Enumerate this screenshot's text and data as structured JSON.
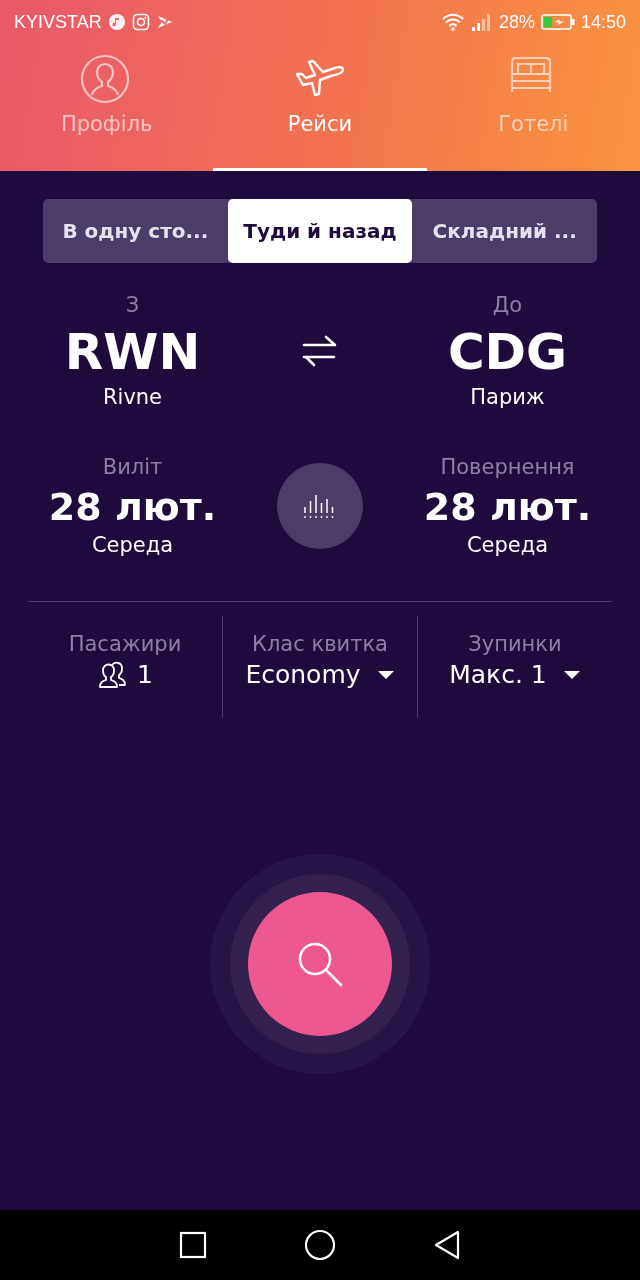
{
  "status_bar": {
    "carrier": "KYIVSTAR",
    "battery": "28%",
    "time": "14:50"
  },
  "nav_tabs": [
    {
      "label": "Профіль",
      "kind": "profile",
      "selected": false
    },
    {
      "label": "Рейси",
      "kind": "plane",
      "selected": true
    },
    {
      "label": "Готелі",
      "kind": "bed",
      "selected": false
    }
  ],
  "trip_types": [
    {
      "label": "В одну сто...",
      "selected": false
    },
    {
      "label": "Туди й назад",
      "selected": true
    },
    {
      "label": "Складний ...",
      "selected": false
    }
  ],
  "route": {
    "from": {
      "label": "З",
      "code": "RWN",
      "city": "Rivne"
    },
    "to": {
      "label": "До",
      "code": "CDG",
      "city": "Париж"
    }
  },
  "dates": {
    "departure": {
      "label": "Виліт",
      "date": "28 лют.",
      "weekday": "Середа"
    },
    "return": {
      "label": "Повернення",
      "date": "28 лют.",
      "weekday": "Середа"
    }
  },
  "options": [
    {
      "kind": "passengers",
      "label": "Пасажири",
      "value": "1"
    },
    {
      "kind": "dropdown",
      "label": "Клас квитка",
      "value": "Economy"
    },
    {
      "kind": "dropdown",
      "label": "Зупинки",
      "value": "Макс. 1"
    }
  ]
}
